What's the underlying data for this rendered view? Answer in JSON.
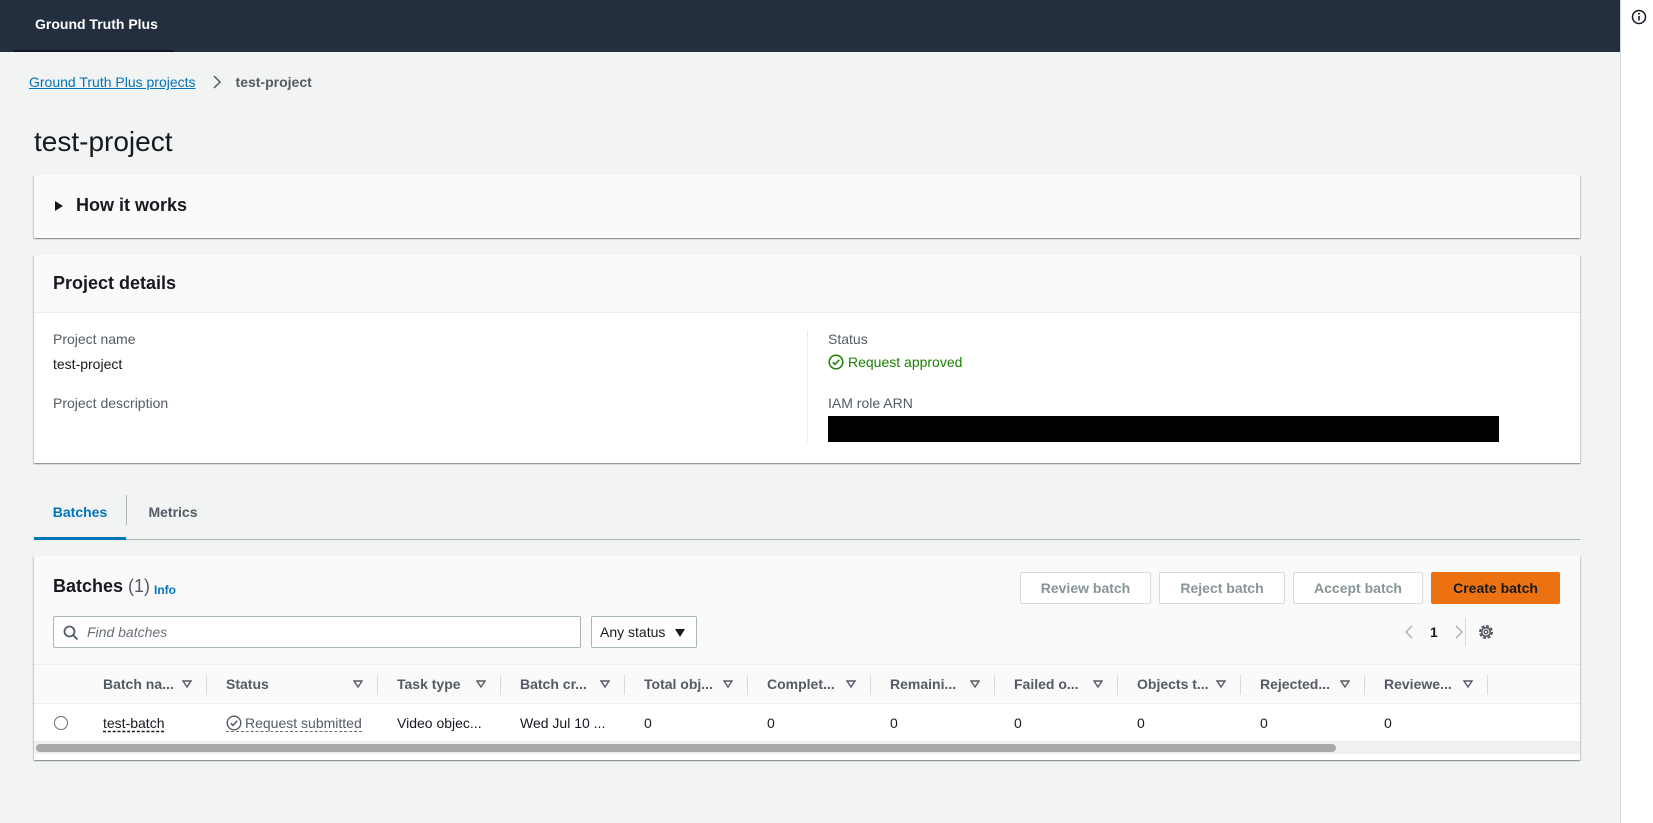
{
  "app": {
    "title": "Ground Truth Plus"
  },
  "breadcrumb": {
    "parent": "Ground Truth Plus projects",
    "current": "test-project"
  },
  "page": {
    "title": "test-project"
  },
  "how_it_works": {
    "label": "How it works"
  },
  "project_details": {
    "title": "Project details",
    "name_label": "Project name",
    "name_value": "test-project",
    "description_label": "Project description",
    "status_label": "Status",
    "status_value": "Request approved",
    "iam_label": "IAM role ARN"
  },
  "tabs": [
    {
      "label": "Batches"
    },
    {
      "label": "Metrics"
    }
  ],
  "batches": {
    "title": "Batches",
    "count": "(1)",
    "info": "Info",
    "buttons": {
      "review": "Review batch",
      "reject": "Reject batch",
      "accept": "Accept batch",
      "create": "Create batch"
    },
    "search_placeholder": "Find batches",
    "status_filter": "Any status",
    "page": "1",
    "columns": [
      "Batch na...",
      "Status",
      "Task type",
      "Batch cr...",
      "Total obj...",
      "Complet...",
      "Remaini...",
      "Failed o...",
      "Objects t...",
      "Rejected...",
      "Reviewe..."
    ],
    "rows": [
      {
        "name": "test-batch",
        "status": "Request submitted",
        "task_type": "Video objec...",
        "created": "Wed Jul 10 ...",
        "total": "0",
        "completed": "0",
        "remaining": "0",
        "failed": "0",
        "objects": "0",
        "rejected": "0",
        "reviewed": "0"
      }
    ]
  },
  "colors": {
    "accent": "#0073bb",
    "primary_button": "#ec7211",
    "success": "#1d8102",
    "header_bg": "#232f3e"
  }
}
